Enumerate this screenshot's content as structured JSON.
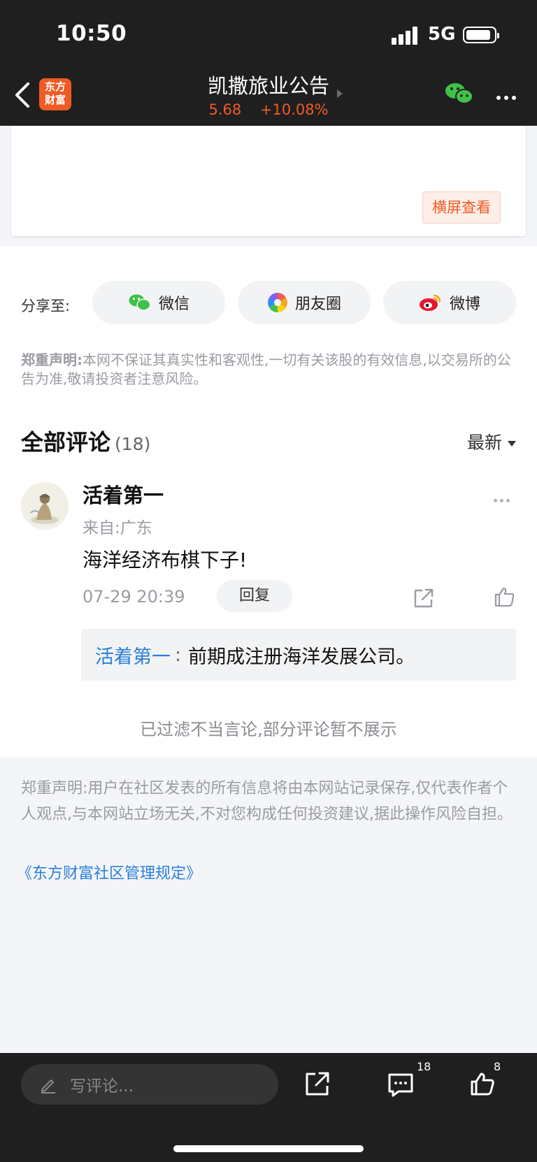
{
  "status": {
    "time": "10:50",
    "network": "5G"
  },
  "header": {
    "logo_line1": "东方",
    "logo_line2": "财富",
    "title": "凯撒旅业公告",
    "price": "5.68",
    "change": "+10.08%"
  },
  "card": {
    "landscape_label": "横屏查看"
  },
  "share": {
    "label": "分享至:",
    "wechat": "微信",
    "moments": "朋友圈",
    "weibo": "微博"
  },
  "disclaimer_top": {
    "prefix": "郑重声明:",
    "text": "本网不保证其真实性和客观性,一切有关该股的有效信息,以交易所的公告为准,敬请投资者注意风险。"
  },
  "comments": {
    "title": "全部评论",
    "count": "(18)",
    "sort_label": "最新",
    "items": [
      {
        "user": "活着第一",
        "location": "来自:广东",
        "body": "海洋经济布棋下子!",
        "time": "07-29 20:39",
        "reply_button": "回复",
        "reply": {
          "name": "活着第一",
          "sep": ":",
          "text": "前期成注册海洋发展公司。"
        }
      }
    ],
    "filtered_notice": "已过滤不当言论,部分评论暂不展示"
  },
  "disclaimer_bottom": {
    "text": "郑重声明:用户在社区发表的所有信息将由本网站记录保存,仅代表作者个人观点,与本网站立场无关,不对您构成任何投资建议,据此操作风险自担。",
    "link": "《东方财富社区管理规定》"
  },
  "bottom_bar": {
    "placeholder": "写评论...",
    "comment_count": "18",
    "like_count": "8"
  },
  "colors": {
    "brand": "#ee5b24",
    "link": "#2a80d8",
    "bar": "#1f1f1f"
  }
}
